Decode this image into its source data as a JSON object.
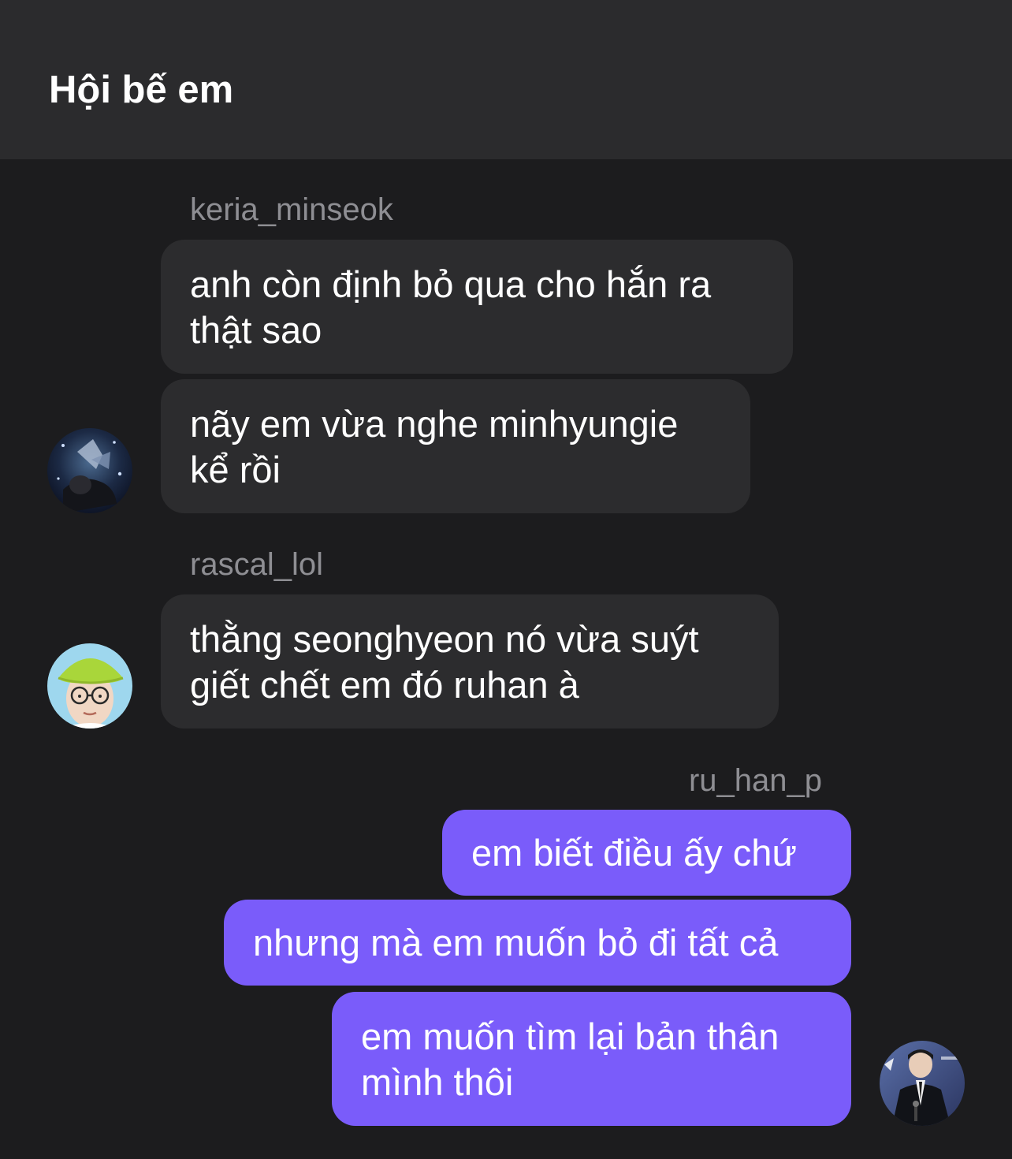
{
  "header": {
    "title": "Hội bế em"
  },
  "groups": [
    {
      "sender": "keria_minseok",
      "avatar_icon": "user-avatar-photo",
      "messages": [
        {
          "lines": [
            "anh còn định bỏ qua cho hắn ra",
            "thật sao"
          ]
        },
        {
          "lines": [
            "nãy em vừa nghe minhyungie",
            "kể rồi"
          ]
        }
      ]
    },
    {
      "sender": "rascal_lol",
      "avatar_icon": "user-avatar-photo",
      "messages": [
        {
          "lines": [
            "thằng seonghyeon nó vừa suýt",
            "giết chết em đó ruhan à"
          ]
        }
      ]
    },
    {
      "sender": "ru_han_p",
      "avatar_icon": "user-avatar-photo",
      "messages": [
        {
          "lines": [
            "em biết điều ấy chứ"
          ]
        },
        {
          "lines": [
            "nhưng mà em muốn bỏ đi tất cả"
          ]
        },
        {
          "lines": [
            "em muốn tìm lại bản thân",
            "mình thôi"
          ]
        }
      ]
    }
  ],
  "colors": {
    "background": "#1c1c1e",
    "header": "#2b2b2d",
    "incoming_bubble": "#2c2c2e",
    "outgoing_bubble": "#7a5cfa",
    "sender_text": "#8e8e93"
  }
}
